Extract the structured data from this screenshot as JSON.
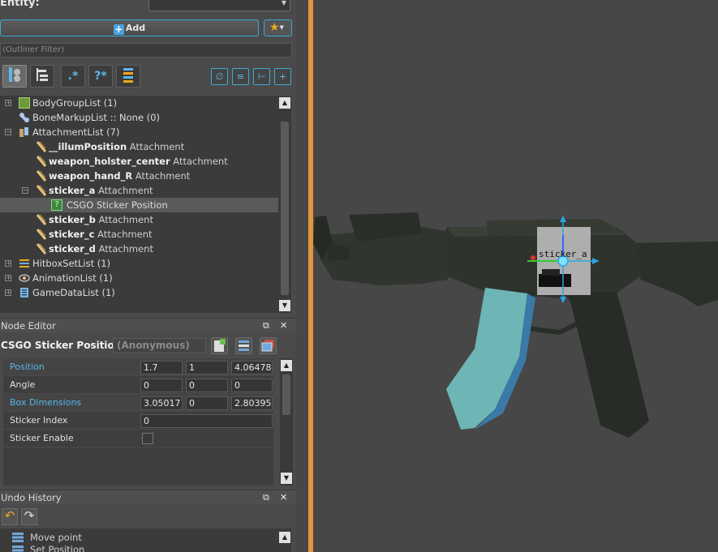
{
  "entity": {
    "label": "Entity:",
    "value": ""
  },
  "toolbar": {
    "add_label": "Add"
  },
  "outliner": {
    "filter_placeholder": "(Outliner Filter)",
    "tool_buttons": [
      ".*",
      "?*"
    ],
    "tree": [
      {
        "name": "BodyGroupList (1)",
        "sub": ""
      },
      {
        "name": "BoneMarkupList :: None (0)",
        "sub": ""
      },
      {
        "name": "AttachmentList (7)",
        "sub": ""
      },
      {
        "name": "__illumPosition",
        "sub": "Attachment"
      },
      {
        "name": "weapon_holster_center",
        "sub": "Attachment"
      },
      {
        "name": "weapon_hand_R",
        "sub": "Attachment"
      },
      {
        "name": "sticker_a",
        "sub": "Attachment"
      },
      {
        "name": "CSGO Sticker Position",
        "sub": ""
      },
      {
        "name": "sticker_b",
        "sub": "Attachment"
      },
      {
        "name": "sticker_c",
        "sub": "Attachment"
      },
      {
        "name": "sticker_d",
        "sub": "Attachment"
      },
      {
        "name": "HitboxSetList (1)",
        "sub": ""
      },
      {
        "name": "AnimationList (1)",
        "sub": ""
      },
      {
        "name": "GameDataList (1)",
        "sub": ""
      }
    ]
  },
  "node_editor": {
    "panel_title": "Node Editor",
    "node_title": "CSGO Sticker Position",
    "node_name_placeholder": "(Anonymous)",
    "properties": [
      {
        "name": "Position",
        "values": [
          "1.7",
          "1",
          "4.06478"
        ]
      },
      {
        "name": "Angle",
        "values": [
          "0",
          "0",
          "0"
        ]
      },
      {
        "name": "Box Dimensions",
        "values": [
          "3.05017",
          "0",
          "2.80395"
        ]
      },
      {
        "name": "Sticker Index",
        "values": [
          "0"
        ]
      },
      {
        "name": "Sticker Enable",
        "checked": false
      }
    ]
  },
  "undo_history": {
    "panel_title": "Undo History",
    "items": [
      "Move point",
      "Set Position"
    ]
  },
  "viewport": {
    "label": "sticker_a"
  },
  "colors": {
    "accent": "#3ea8d8",
    "divider": "#e2953a",
    "gun_body": "#2b3028",
    "magazine": "#6fb7b7",
    "highlight_text": "#55b8ec"
  }
}
